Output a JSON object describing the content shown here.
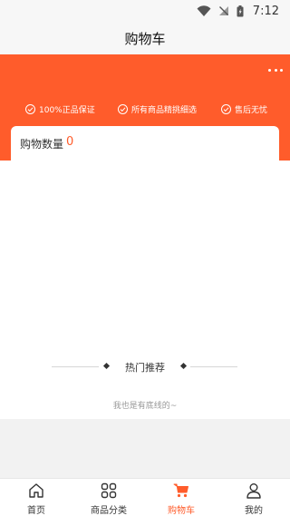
{
  "status_bar": {
    "time": "7:12"
  },
  "header": {
    "title": "购物车"
  },
  "guarantees": [
    {
      "label": "100%正品保证"
    },
    {
      "label": "所有商品精挑细选"
    },
    {
      "label": "售后无忧"
    }
  ],
  "cart": {
    "count_label": "购物数量",
    "count_value": "0"
  },
  "recommend": {
    "title": "热门推荐",
    "end_text": "我也是有底线的~"
  },
  "tabs": [
    {
      "label": "首页",
      "icon": "home-icon"
    },
    {
      "label": "商品分类",
      "icon": "grid-icon"
    },
    {
      "label": "购物车",
      "icon": "cart-icon",
      "active": true
    },
    {
      "label": "我的",
      "icon": "user-icon"
    }
  ],
  "colors": {
    "accent": "#ff5c2b",
    "background": "#f2f2f2"
  }
}
